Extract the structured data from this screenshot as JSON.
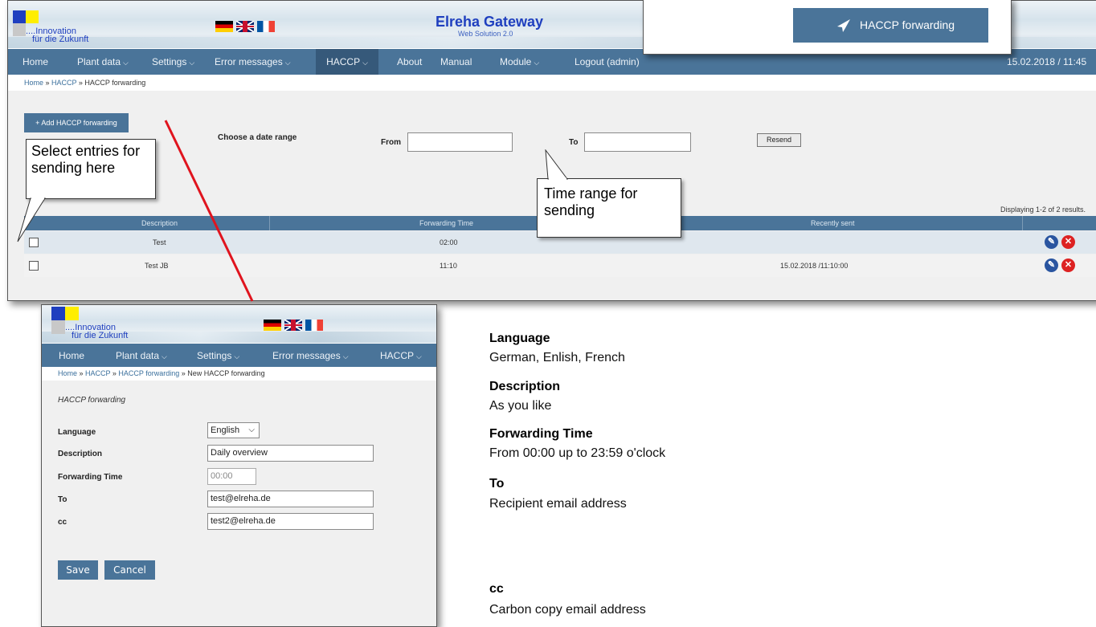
{
  "app": {
    "logo_line1": "....Innovation",
    "logo_line2": "für die Zukunft",
    "title": "Elreha Gateway",
    "subtitle": "Web Solution 2.0"
  },
  "nav": {
    "items": [
      {
        "label": "Home",
        "caret": false
      },
      {
        "label": "Plant data",
        "caret": true
      },
      {
        "label": "Settings",
        "caret": true
      },
      {
        "label": "Error messages",
        "caret": true
      },
      {
        "label": "HACCP",
        "caret": true
      },
      {
        "label": "About",
        "caret": false
      },
      {
        "label": "Manual",
        "caret": false
      },
      {
        "label": "Module",
        "caret": true
      },
      {
        "label": "Logout (admin)",
        "caret": false
      }
    ],
    "datetime": "15.02.2018 / 11:45"
  },
  "breadcrumb": {
    "home": "Home",
    "sep": " » ",
    "haccp": "HACCP",
    "current": "HACCP forwarding"
  },
  "list_page": {
    "add_button": "+ Add HACCP forwarding",
    "date_range_label": "Choose a date range",
    "from_label": "From",
    "to_label": "To",
    "resend_button": "Resend",
    "results": "Displaying 1-2 of 2 results.",
    "columns": [
      "Description",
      "Forwarding Time",
      "Recently sent"
    ],
    "rows": [
      {
        "description": "Test",
        "time": "02:00",
        "sent": ""
      },
      {
        "description": "Test JB",
        "time": "11:10",
        "sent": "15.02.2018 /11:10:00"
      }
    ]
  },
  "menu_popup": {
    "label": "HACCP forwarding"
  },
  "callouts": {
    "select": "Select entries for sending here",
    "time_range": "Time range for sending"
  },
  "form_page": {
    "nav": [
      {
        "label": "Home",
        "caret": false
      },
      {
        "label": "Plant data",
        "caret": true
      },
      {
        "label": "Settings",
        "caret": true
      },
      {
        "label": "Error messages",
        "caret": true
      },
      {
        "label": "HACCP",
        "caret": true
      }
    ],
    "breadcrumb": {
      "home": "Home",
      "haccp": "HACCP",
      "forwarding": "HACCP forwarding",
      "current": "New HACCP forwarding"
    },
    "section_title": "HACCP forwarding",
    "fields": {
      "language": {
        "label": "Language",
        "value": "English"
      },
      "description": {
        "label": "Description",
        "value": "Daily overview"
      },
      "time": {
        "label": "Forwarding Time",
        "value": "00:00"
      },
      "to": {
        "label": "To",
        "value": "test@elreha.de"
      },
      "cc": {
        "label": "cc",
        "value": "test2@elreha.de"
      }
    },
    "save": "Save",
    "cancel": "Cancel"
  },
  "info": [
    {
      "heading": "Language",
      "text": "German, Enlish, French"
    },
    {
      "heading": "Description",
      "text": "As you like"
    },
    {
      "heading": "Forwarding Time",
      "text": "From 00:00 up to 23:59 o'clock"
    },
    {
      "heading": "To",
      "text": "Recipient email address"
    },
    {
      "heading": "cc",
      "text": "Carbon copy email address"
    }
  ],
  "colors": {
    "nav": "#4a7499",
    "nav_active": "#36597a",
    "edit": "#2a55a0",
    "delete": "#dd2222",
    "arrow": "#e0141e"
  }
}
